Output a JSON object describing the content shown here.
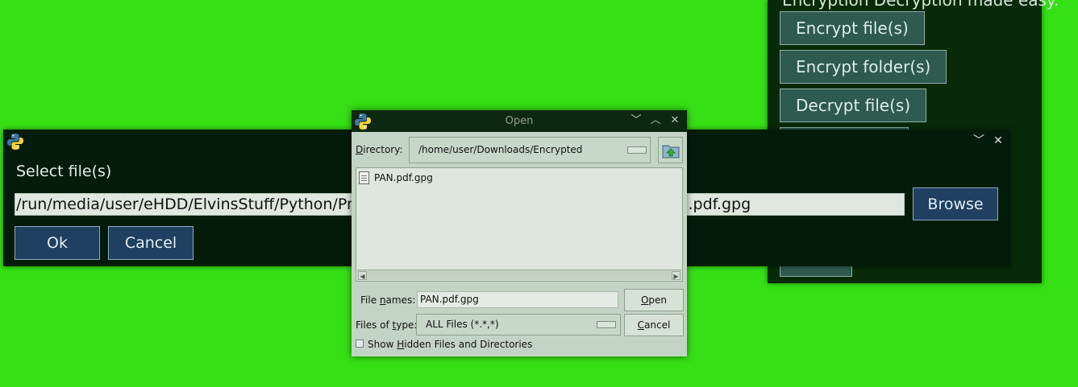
{
  "main_window": {
    "tagline": "Encryption Decryption made easy.",
    "buttons": {
      "encrypt_files": "Encrypt file(s)",
      "encrypt_folders": "Encrypt folder(s)",
      "decrypt_files": "Decrypt file(s)"
    }
  },
  "select_dialog": {
    "label": "Select file(s)",
    "path_value": "/run/media/user/eHDD/ElvinsStuff/Python/Projects/EncryptionDecryption/Encrypted/PAN.pdf.gpg",
    "browse_label": "Browse",
    "ok_label": "Ok",
    "cancel_label": "Cancel",
    "window_buttons": {
      "minimize": "﹀",
      "close": "✕"
    }
  },
  "open_dialog": {
    "title": "Open",
    "window_buttons": {
      "minimize": "﹀",
      "maximize": "︿",
      "close": "✕"
    },
    "directory_label_prefix": "D",
    "directory_label_rest": "irectory:",
    "directory_value": "/home/user/Downloads/Encrypted",
    "files": [
      "PAN.pdf.gpg"
    ],
    "file_names_label_a": "File ",
    "file_names_label_u": "n",
    "file_names_label_b": "ames:",
    "file_names_value": "PAN.pdf.gpg",
    "open_label_u": "O",
    "open_label_rest": "pen",
    "files_of_type_label_a": "Files of ",
    "files_of_type_label_u": "t",
    "files_of_type_label_b": "ype:",
    "files_of_type_value": "ALL Files (*.*,*)",
    "cancel_label_u": "C",
    "cancel_label_rest": "ancel",
    "show_hidden_a": "Show ",
    "show_hidden_u": "H",
    "show_hidden_b": "idden Files and Directories",
    "show_hidden_checked": false
  }
}
